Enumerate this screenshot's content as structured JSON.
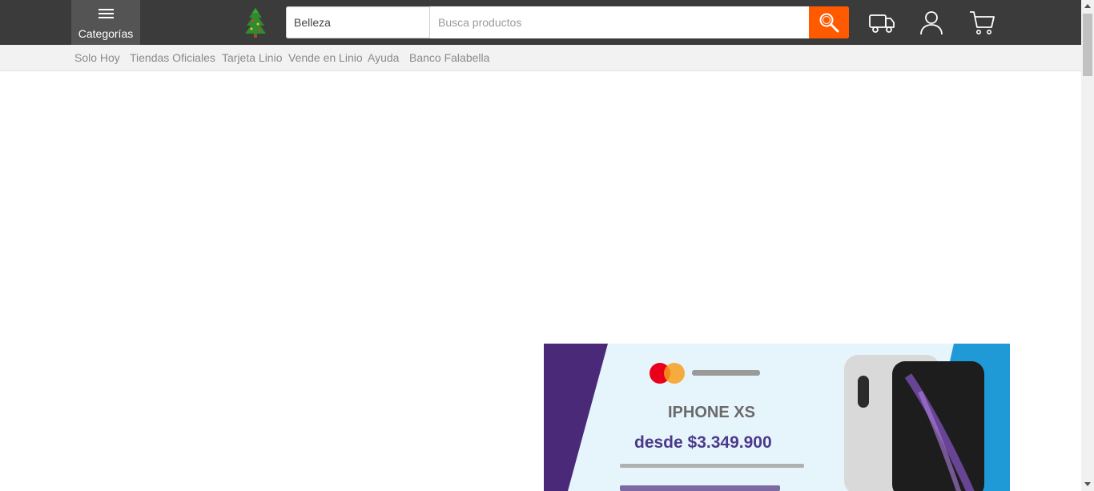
{
  "header": {
    "categories_label": "Categorías",
    "search": {
      "category_value": "Belleza",
      "placeholder": "Busca productos"
    },
    "icons": [
      "menu-icon",
      "christmas-tree-logo-icon",
      "search-icon",
      "truck-icon",
      "user-icon",
      "cart-icon"
    ]
  },
  "subnav": {
    "links": [
      "Solo Hoy",
      "Tiendas Oficiales",
      "Tarjeta Linio",
      "Vende en Linio",
      "Ayuda",
      "Banco Falabella"
    ]
  },
  "banner": {
    "product": "IPHONE XS",
    "price": "desde $3.349.900"
  },
  "colors": {
    "topbar": "#3b3b3b",
    "accent": "#ff5a00",
    "subnav": "#f2f2f2"
  }
}
